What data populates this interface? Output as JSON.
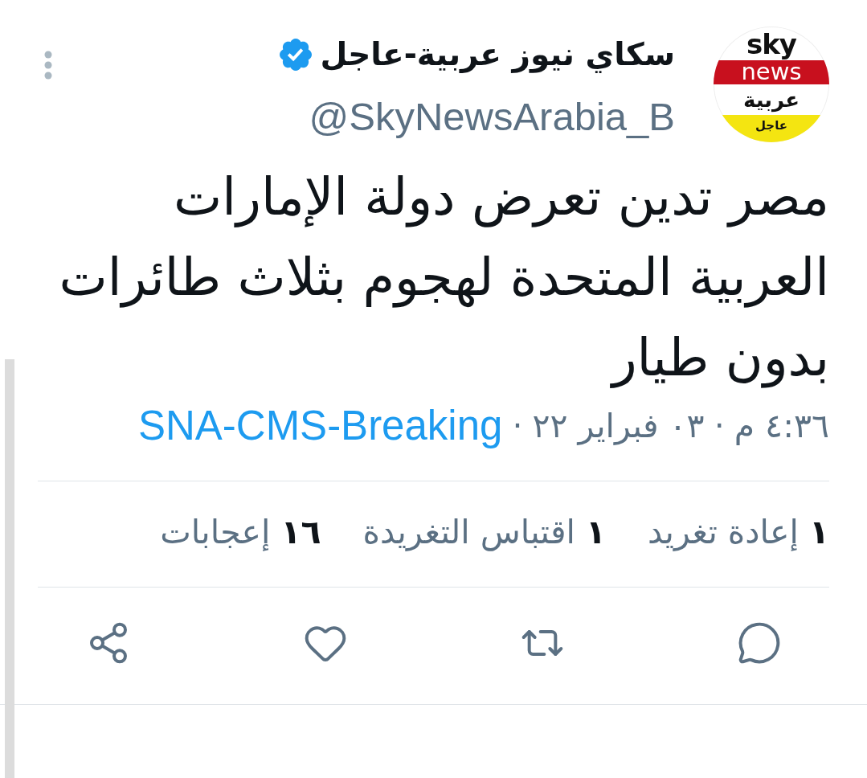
{
  "tweet": {
    "avatar": {
      "top": "sky",
      "band": "news",
      "middle": "عربية",
      "bottom": "عاجل"
    },
    "author": {
      "name": "سكاي نيوز عربية-عاجل",
      "verified": true,
      "handle": "@SkyNewsArabia_B"
    },
    "text": "مصر تدين تعرض دولة الإمارات العربية المتحدة لهجوم بثلاث طائرات بدون طيار",
    "meta": [
      {
        "kind": "time",
        "text": "٤:٣٦ م"
      },
      {
        "kind": "separator",
        "text": "·"
      },
      {
        "kind": "date",
        "text": "٠٣ فبراير ٢٢"
      },
      {
        "kind": "separator",
        "text": "·"
      },
      {
        "kind": "source",
        "text": "SNA-CMS-Breaking"
      }
    ],
    "stats": [
      {
        "count": "١",
        "label": "إعادة تغريد"
      },
      {
        "count": "١",
        "label": "اقتباس التغريدة"
      },
      {
        "count": "١٦",
        "label": "إعجابات"
      }
    ],
    "actions": [
      {
        "kind": "reply"
      },
      {
        "kind": "retweet"
      },
      {
        "kind": "like"
      },
      {
        "kind": "share"
      }
    ]
  }
}
